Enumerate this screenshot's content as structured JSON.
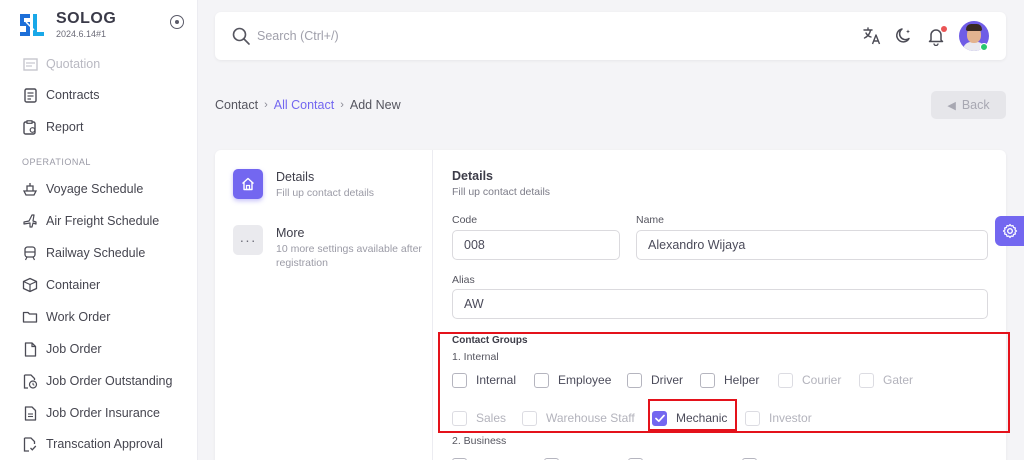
{
  "brand": {
    "name": "SOLOG",
    "version": "2024.6.14#1"
  },
  "sidebar": {
    "top_items": [
      {
        "label": "Quotation",
        "icon": "quotation-icon"
      },
      {
        "label": "Contracts",
        "icon": "document-icon"
      },
      {
        "label": "Report",
        "icon": "report-icon"
      }
    ],
    "section_label": "OPERATIONAL",
    "items": [
      {
        "label": "Voyage Schedule",
        "icon": "ship-icon"
      },
      {
        "label": "Air Freight Schedule",
        "icon": "plane-icon"
      },
      {
        "label": "Railway Schedule",
        "icon": "train-icon"
      },
      {
        "label": "Container",
        "icon": "box-icon"
      },
      {
        "label": "Work Order",
        "icon": "folder-icon"
      },
      {
        "label": "Job Order",
        "icon": "file-icon"
      },
      {
        "label": "Job Order Outstanding",
        "icon": "file-clock-icon"
      },
      {
        "label": "Job Order Insurance",
        "icon": "file-text-icon"
      },
      {
        "label": "Transcation Approval",
        "icon": "file-check-icon"
      }
    ]
  },
  "search": {
    "placeholder": "Search (Ctrl+/)"
  },
  "breadcrumb": {
    "root": "Contact",
    "parent": "All Contact",
    "current": "Add New"
  },
  "back_label": "Back",
  "steps": [
    {
      "title": "Details",
      "subtitle": "Fill up contact details",
      "icon": "home-icon"
    },
    {
      "title": "More",
      "subtitle": "10 more settings available after registration",
      "icon": "more-icon"
    }
  ],
  "form": {
    "title": "Details",
    "subtitle": "Fill up contact details",
    "code_label": "Code",
    "code_value": "008",
    "name_label": "Name",
    "name_value": "Alexandro Wijaya",
    "alias_label": "Alias",
    "alias_value": "AW",
    "groups_title": "Contact Groups",
    "internal_label": "1. Internal",
    "business_label": "2. Business",
    "internal_groups": [
      {
        "label": "Internal",
        "checked": false,
        "disabled": false
      },
      {
        "label": "Employee",
        "checked": false,
        "disabled": false
      },
      {
        "label": "Driver",
        "checked": false,
        "disabled": false
      },
      {
        "label": "Helper",
        "checked": false,
        "disabled": false
      },
      {
        "label": "Courier",
        "checked": false,
        "disabled": true
      },
      {
        "label": "Gater",
        "checked": false,
        "disabled": true
      },
      {
        "label": "Sales",
        "checked": false,
        "disabled": true
      },
      {
        "label": "Warehouse Staff",
        "checked": false,
        "disabled": true
      },
      {
        "label": "Mechanic",
        "checked": true,
        "disabled": false
      },
      {
        "label": "Investor",
        "checked": false,
        "disabled": true
      }
    ]
  },
  "colors": {
    "accent": "#7367f0",
    "highlight": "#e4121b",
    "online": "#28c76f",
    "notification": "#ea5455"
  }
}
